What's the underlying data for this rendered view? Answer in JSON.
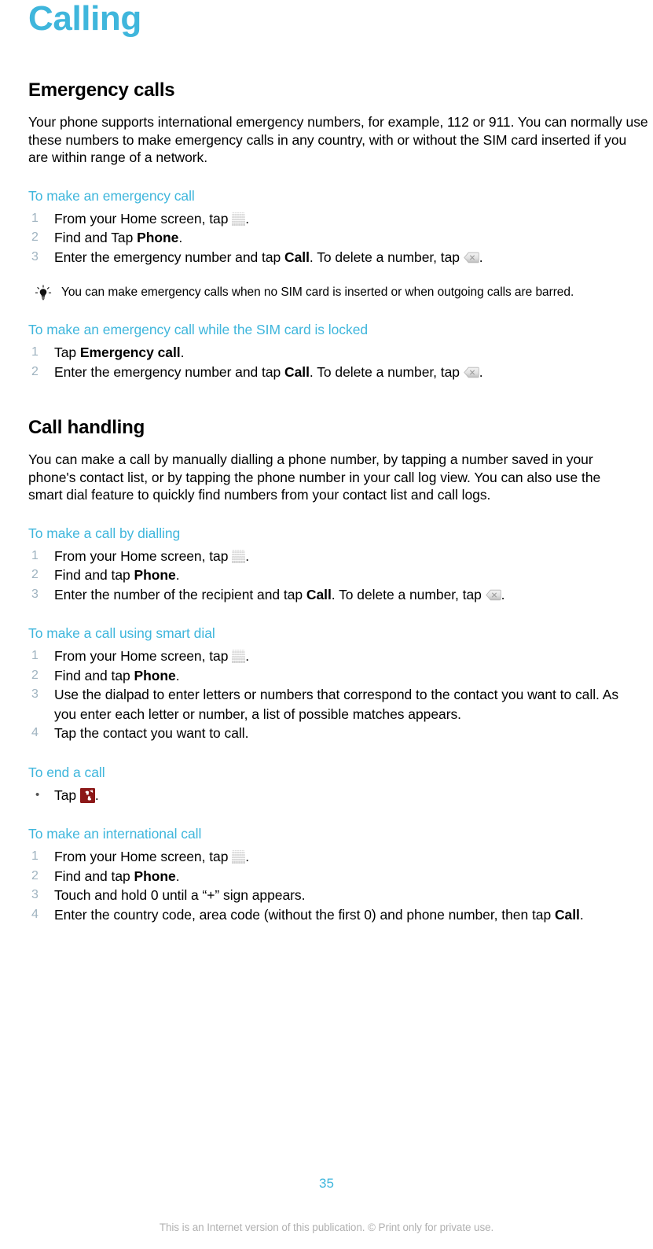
{
  "document": {
    "chapter_title": "Calling",
    "page_number": "35",
    "legal_notice": "This is an Internet version of this publication. © Print only for private use."
  },
  "colors": {
    "accent": "#3fb6dc",
    "text": "#000000",
    "muted": "#b0b0b0",
    "step_number": "#9fb3c0",
    "endcall_red": "#8c1818"
  },
  "sections": [
    {
      "heading": "Emergency calls",
      "intro": "Your phone supports international emergency numbers, for example, 112 or 911. You can normally use these numbers to make emergency calls in any country, with or without the SIM card inserted if you are within range of a network.",
      "tasks": [
        {
          "title": "To make an emergency call",
          "list_type": "ordered",
          "steps": [
            {
              "number": "1",
              "pre": "From your Home screen, tap ",
              "icon": "app-grid-icon",
              "post": "."
            },
            {
              "number": "2",
              "pre": "Find and Tap ",
              "bold": "Phone",
              "post": "."
            },
            {
              "number": "3",
              "pre": "Enter the emergency number and tap ",
              "bold": "Call",
              "mid": ". To delete a number, tap ",
              "icon": "backspace-icon",
              "post": "."
            }
          ]
        }
      ],
      "tip": {
        "icon": "lightbulb-icon",
        "text": "You can make emergency calls when no SIM card is inserted or when outgoing calls are barred."
      },
      "tasks_after_tip": [
        {
          "title": "To make an emergency call while the SIM card is locked",
          "list_type": "ordered",
          "steps": [
            {
              "number": "1",
              "pre": "Tap ",
              "bold": "Emergency call",
              "post": "."
            },
            {
              "number": "2",
              "pre": "Enter the emergency number and tap ",
              "bold": "Call",
              "mid": ". To delete a number, tap ",
              "icon": "backspace-icon",
              "post": "."
            }
          ]
        }
      ]
    },
    {
      "heading": "Call handling",
      "intro": "You can make a call by manually dialling a phone number, by tapping a number saved in your phone's contact list, or by tapping the phone number in your call log view. You can also use the smart dial feature to quickly find numbers from your contact list and call logs.",
      "tasks": [
        {
          "title": "To make a call by dialling",
          "list_type": "ordered",
          "steps": [
            {
              "number": "1",
              "pre": "From your Home screen, tap ",
              "icon": "app-grid-icon",
              "post": "."
            },
            {
              "number": "2",
              "pre": "Find and tap ",
              "bold": "Phone",
              "post": "."
            },
            {
              "number": "3",
              "pre": "Enter the number of the recipient and tap ",
              "bold": "Call",
              "mid": ". To delete a number, tap ",
              "icon": "backspace-icon",
              "post": "."
            }
          ]
        },
        {
          "title": "To make a call using smart dial",
          "list_type": "ordered",
          "steps": [
            {
              "number": "1",
              "pre": "From your Home screen, tap ",
              "icon": "app-grid-icon",
              "post": "."
            },
            {
              "number": "2",
              "pre": "Find and tap ",
              "bold": "Phone",
              "post": "."
            },
            {
              "number": "3",
              "pre": "Use the dialpad to enter letters or numbers that correspond to the contact you want to call. As you enter each letter or number, a list of possible matches appears.",
              "post": ""
            },
            {
              "number": "4",
              "pre": "Tap the contact you want to call.",
              "post": ""
            }
          ]
        },
        {
          "title": "To end a call",
          "list_type": "bullet",
          "steps": [
            {
              "number": "•",
              "pre": "Tap ",
              "icon": "end-call-icon",
              "post": "."
            }
          ]
        },
        {
          "title": "To make an international call",
          "list_type": "ordered",
          "steps": [
            {
              "number": "1",
              "pre": "From your Home screen, tap ",
              "icon": "app-grid-icon",
              "post": "."
            },
            {
              "number": "2",
              "pre": "Find and tap ",
              "bold": "Phone",
              "post": "."
            },
            {
              "number": "3",
              "pre": "Touch and hold 0 until a “+” sign appears.",
              "post": ""
            },
            {
              "number": "4",
              "pre": "Enter the country code, area code (without the first 0) and phone number, then tap ",
              "bold": "Call",
              "post": "."
            }
          ]
        }
      ]
    }
  ]
}
